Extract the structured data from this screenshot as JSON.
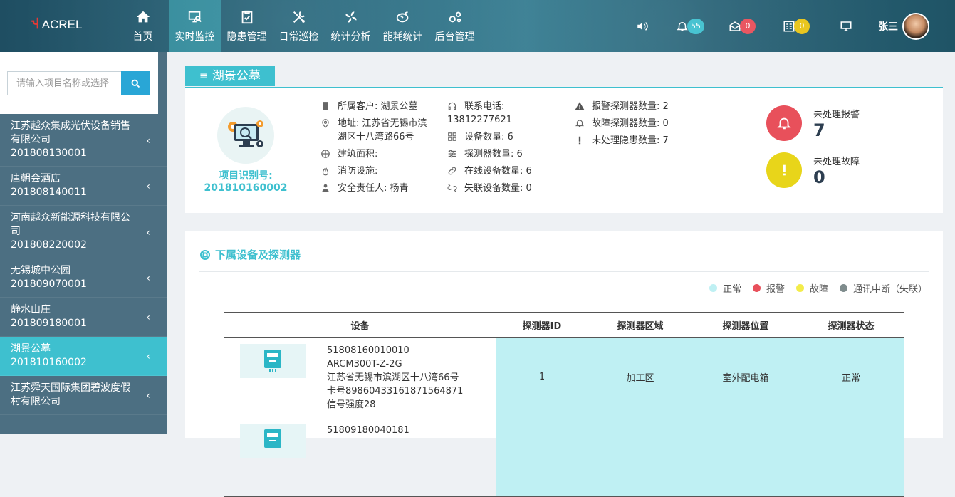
{
  "logo": {
    "text": "ACREL"
  },
  "nav": [
    {
      "label": "首页",
      "icon": "home-icon"
    },
    {
      "label": "实时监控",
      "icon": "monitor-icon",
      "active": true
    },
    {
      "label": "隐患管理",
      "icon": "clipboard-icon"
    },
    {
      "label": "日常巡检",
      "icon": "tools-icon"
    },
    {
      "label": "统计分析",
      "icon": "fan-icon"
    },
    {
      "label": "能耗统计",
      "icon": "energy-icon"
    },
    {
      "label": "后台管理",
      "icon": "gears-icon"
    }
  ],
  "toolbar": {
    "alarm_count": "55",
    "message_count": "0",
    "task_count": "0",
    "user_name": "张三",
    "colors": {
      "alarm": "#3ec0cf",
      "message": "#e8505b",
      "task": "#e8c51a"
    }
  },
  "sidebar": {
    "search_placeholder": "请输入项目名称或选择",
    "projects": [
      {
        "name": "江苏越众集成光伏设备销售有限公司",
        "id": "201808130001"
      },
      {
        "name": "唐朝会酒店",
        "id": "201808140011"
      },
      {
        "name": "河南越众新能源科技有限公司",
        "id": "201808220002"
      },
      {
        "name": "无锡城中公园",
        "id": "201809070001"
      },
      {
        "name": "静水山庄",
        "id": "201809180001"
      },
      {
        "name": "湖景公墓",
        "id": "201810160002",
        "active": true
      },
      {
        "name": "江苏舜天国际集团碧波度假村有限公司",
        "id": ""
      }
    ]
  },
  "project": {
    "title": "湖景公墓",
    "id_label": "项目识别号:",
    "id": "201810160002",
    "owner": "所属客户: 湖景公墓",
    "address": "地址: 江苏省无锡市滨湖区十八湾路66号",
    "area": "建筑面积:",
    "fire": "消防设施:",
    "safety": "安全责任人: 杨青",
    "phone_label": "联系电话:",
    "phone": "13812277621",
    "device_count": "设备数量: 6",
    "detector_count": "探测器数量: 6",
    "online_count": "在线设备数量: 6",
    "offline_count": "失联设备数量: 0",
    "alarm_detectors": "报警探测器数量: 2",
    "fault_detectors": "故障探测器数量: 0",
    "unhandled_hazards": "未处理隐患数量: 7",
    "unhandled_alarm_label": "未处理报警",
    "unhandled_alarm_value": "7",
    "unhandled_fault_label": "未处理故障",
    "unhandled_fault_value": "0",
    "colors": {
      "alarm": "#e8505b",
      "fault": "#e8d51a"
    }
  },
  "devices": {
    "title": "下属设备及探测器",
    "legend": [
      {
        "label": "正常",
        "color": "#bff0f3"
      },
      {
        "label": "报警",
        "color": "#e8505b"
      },
      {
        "label": "故障",
        "color": "#f3ec4a"
      },
      {
        "label": "通讯中断（失联）",
        "color": "#7f8c8d"
      }
    ],
    "columns": [
      "设备",
      "探测器ID",
      "探测器区域",
      "探测器位置",
      "探测器状态"
    ],
    "rows": [
      {
        "serial": "51808160010010",
        "model": "ARCM300T-Z-2G",
        "address": "江苏省无锡市滨湖区十八湾66号",
        "card": "卡号89860433161871564871",
        "signal": "信号强度28",
        "detector_id": "1",
        "area": "加工区",
        "location": "室外配电箱",
        "status": "正常"
      },
      {
        "serial": "51809180040181",
        "model": "",
        "address": "",
        "card": "",
        "signal": "",
        "detector_id": "",
        "area": "",
        "location": "",
        "status": ""
      }
    ]
  }
}
